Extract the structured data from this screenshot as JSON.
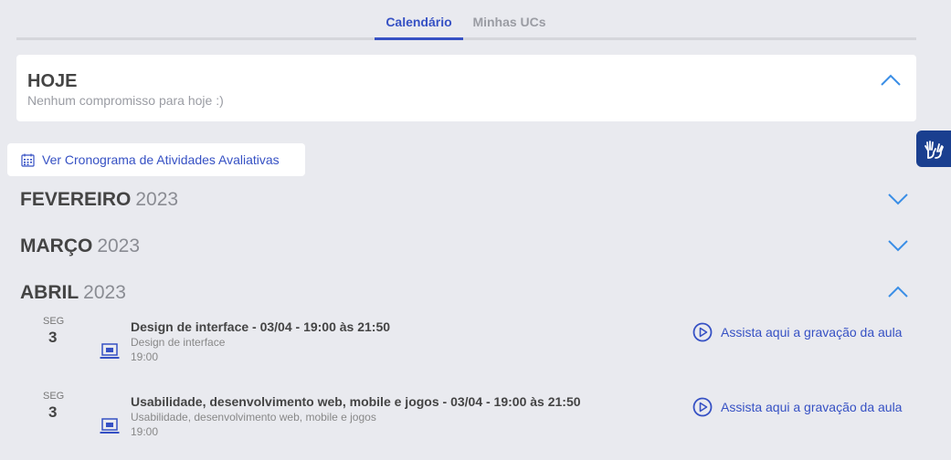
{
  "tabs": [
    {
      "label": "Calendário",
      "active": true
    },
    {
      "label": "Minhas UCs",
      "active": false
    }
  ],
  "today": {
    "title": "HOJE",
    "message": "Nenhum compromisso para hoje :)",
    "icon": "chevron-up-icon"
  },
  "schedule_button": {
    "label": "Ver Cronograma de Atividades Avaliativas",
    "icon": "calendar-icon"
  },
  "accessibility": {
    "icon": "sign-language-hands-icon"
  },
  "months": [
    {
      "name": "FEVEREIRO",
      "year": "2023",
      "expanded": false
    },
    {
      "name": "MARÇO",
      "year": "2023",
      "expanded": false
    },
    {
      "name": "ABRIL",
      "year": "2023",
      "expanded": true
    }
  ],
  "events": [
    {
      "weekday": "SEG",
      "day": "3",
      "title": "Design de interface - 03/04 - 19:00 às 21:50",
      "subtitle": "Design de interface",
      "time": "19:00",
      "link_label": "Assista aqui a gravação da aula",
      "icon": "laptop-icon"
    },
    {
      "weekday": "SEG",
      "day": "3",
      "title": "Usabilidade, desenvolvimento web, mobile e jogos - 03/04 - 19:00 às 21:50",
      "subtitle": "Usabilidade, desenvolvimento web, mobile e jogos",
      "time": "19:00",
      "link_label": "Assista aqui a gravação da aula",
      "icon": "laptop-icon"
    }
  ],
  "colors": {
    "accent": "#3651c4",
    "chevron": "#3a8ee6",
    "background": "#e9eaef",
    "a11y_bg": "#1a3f8f"
  }
}
